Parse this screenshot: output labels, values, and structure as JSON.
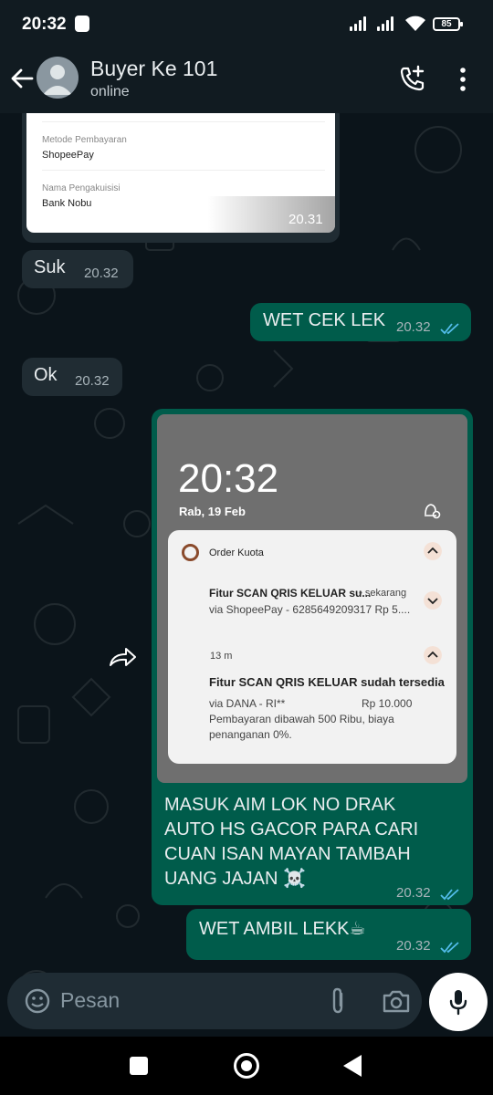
{
  "status_bar": {
    "time": "20:32",
    "battery": "85"
  },
  "header": {
    "contact_name": "Buyer Ke 101",
    "contact_status": "online"
  },
  "screenshot_card": {
    "label_payment_method": "Metode Pembayaran",
    "value_payment_method": "ShopeePay",
    "label_acquirer": "Nama Pengakuisisi",
    "value_acquirer": "Bank Nobu",
    "time": "20.31"
  },
  "messages": [
    {
      "direction": "incoming",
      "text": "Suk",
      "time": "20.32"
    },
    {
      "direction": "outgoing",
      "text": "WET CEK LEK",
      "time": "20.32",
      "read": true
    },
    {
      "direction": "incoming",
      "text": "Ok",
      "time": "20.32"
    },
    {
      "direction": "outgoing",
      "text_lines": [
        "MASUK AIM LOK NO DRAK",
        "AUTO HS GACOR PARA CARI",
        "CUAN ISAN MAYAN TAMBAH",
        "UANG JAJAN ☠️"
      ],
      "time": "20.32",
      "read": true
    },
    {
      "direction": "outgoing",
      "text": "WET AMBIL LEKK☕",
      "time": "20.32",
      "read": true
    }
  ],
  "lock_screen": {
    "time": "20:32",
    "date": "Rab, 19 Feb",
    "app_name": "Order Kuota",
    "notif1_title": "Fitur SCAN QRIS KELUAR su...",
    "notif1_when": "• sekarang",
    "notif1_body": "via ShopeePay - 6285649209317 Rp 5....",
    "notif2_when": "13 m",
    "notif2_title": "Fitur SCAN QRIS KELUAR sudah tersedia",
    "notif2_line1_left": "via DANA - RI**",
    "notif2_line1_right": "Rp 10.000",
    "notif2_line2": "Pembayaran dibawah 500 Ribu, biaya",
    "notif2_line3": "penanganan 0%."
  },
  "input": {
    "placeholder": "Pesan"
  },
  "colors": {
    "outgoing_bubble": "#005c4b",
    "incoming_bubble": "#202c33",
    "read_ticks": "#53bdeb"
  },
  "icons": [
    "back-arrow-icon",
    "add-call-icon",
    "more-vert-icon",
    "forward-icon",
    "emoji-icon",
    "attach-icon",
    "camera-icon",
    "mic-icon"
  ]
}
